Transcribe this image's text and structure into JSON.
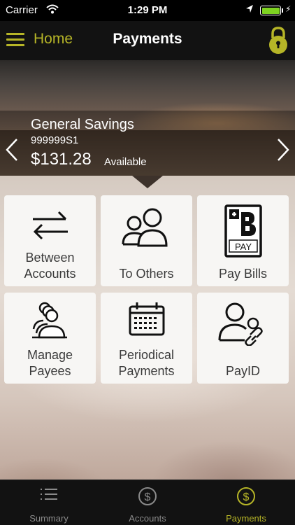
{
  "status_bar": {
    "carrier": "Carrier",
    "time": "1:29 PM"
  },
  "header": {
    "home_label": "Home",
    "title": "Payments"
  },
  "account": {
    "name": "General Savings",
    "number": "999999S1",
    "balance": "$131.28",
    "balance_label": "Available"
  },
  "tiles": [
    {
      "line1": "Between",
      "line2": "Accounts",
      "icon": "transfer-arrows-icon"
    },
    {
      "line1": "",
      "line2": "To Others",
      "icon": "people-icon"
    },
    {
      "line1": "",
      "line2": "Pay Bills",
      "icon": "bpay-icon",
      "icon_text": "PAY"
    },
    {
      "line1": "Manage",
      "line2": "Payees",
      "icon": "payees-stack-icon"
    },
    {
      "line1": "Periodical",
      "line2": "Payments",
      "icon": "calendar-icon"
    },
    {
      "line1": "",
      "line2": "PayID",
      "icon": "payid-icon"
    }
  ],
  "tabbar": {
    "items": [
      {
        "label": "Summary",
        "icon": "list-icon"
      },
      {
        "label": "Accounts",
        "icon": "dollar-icon"
      },
      {
        "label": "Payments",
        "icon": "dollar-icon",
        "active": true
      }
    ]
  },
  "colors": {
    "accent": "#b6b527",
    "battery": "#7ed321",
    "header_bg": "#121212",
    "tile_bg": "#f7f6f4"
  }
}
